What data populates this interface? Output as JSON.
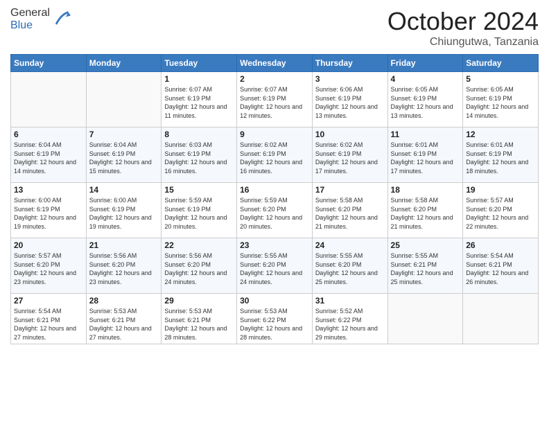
{
  "logo": {
    "general": "General",
    "blue": "Blue"
  },
  "title": "October 2024",
  "subtitle": "Chiungutwa, Tanzania",
  "days_of_week": [
    "Sunday",
    "Monday",
    "Tuesday",
    "Wednesday",
    "Thursday",
    "Friday",
    "Saturday"
  ],
  "weeks": [
    [
      {
        "day": "",
        "info": ""
      },
      {
        "day": "",
        "info": ""
      },
      {
        "day": "1",
        "info": "Sunrise: 6:07 AM\nSunset: 6:19 PM\nDaylight: 12 hours and 11 minutes."
      },
      {
        "day": "2",
        "info": "Sunrise: 6:07 AM\nSunset: 6:19 PM\nDaylight: 12 hours and 12 minutes."
      },
      {
        "day": "3",
        "info": "Sunrise: 6:06 AM\nSunset: 6:19 PM\nDaylight: 12 hours and 13 minutes."
      },
      {
        "day": "4",
        "info": "Sunrise: 6:05 AM\nSunset: 6:19 PM\nDaylight: 12 hours and 13 minutes."
      },
      {
        "day": "5",
        "info": "Sunrise: 6:05 AM\nSunset: 6:19 PM\nDaylight: 12 hours and 14 minutes."
      }
    ],
    [
      {
        "day": "6",
        "info": "Sunrise: 6:04 AM\nSunset: 6:19 PM\nDaylight: 12 hours and 14 minutes."
      },
      {
        "day": "7",
        "info": "Sunrise: 6:04 AM\nSunset: 6:19 PM\nDaylight: 12 hours and 15 minutes."
      },
      {
        "day": "8",
        "info": "Sunrise: 6:03 AM\nSunset: 6:19 PM\nDaylight: 12 hours and 16 minutes."
      },
      {
        "day": "9",
        "info": "Sunrise: 6:02 AM\nSunset: 6:19 PM\nDaylight: 12 hours and 16 minutes."
      },
      {
        "day": "10",
        "info": "Sunrise: 6:02 AM\nSunset: 6:19 PM\nDaylight: 12 hours and 17 minutes."
      },
      {
        "day": "11",
        "info": "Sunrise: 6:01 AM\nSunset: 6:19 PM\nDaylight: 12 hours and 17 minutes."
      },
      {
        "day": "12",
        "info": "Sunrise: 6:01 AM\nSunset: 6:19 PM\nDaylight: 12 hours and 18 minutes."
      }
    ],
    [
      {
        "day": "13",
        "info": "Sunrise: 6:00 AM\nSunset: 6:19 PM\nDaylight: 12 hours and 19 minutes."
      },
      {
        "day": "14",
        "info": "Sunrise: 6:00 AM\nSunset: 6:19 PM\nDaylight: 12 hours and 19 minutes."
      },
      {
        "day": "15",
        "info": "Sunrise: 5:59 AM\nSunset: 6:19 PM\nDaylight: 12 hours and 20 minutes."
      },
      {
        "day": "16",
        "info": "Sunrise: 5:59 AM\nSunset: 6:20 PM\nDaylight: 12 hours and 20 minutes."
      },
      {
        "day": "17",
        "info": "Sunrise: 5:58 AM\nSunset: 6:20 PM\nDaylight: 12 hours and 21 minutes."
      },
      {
        "day": "18",
        "info": "Sunrise: 5:58 AM\nSunset: 6:20 PM\nDaylight: 12 hours and 21 minutes."
      },
      {
        "day": "19",
        "info": "Sunrise: 5:57 AM\nSunset: 6:20 PM\nDaylight: 12 hours and 22 minutes."
      }
    ],
    [
      {
        "day": "20",
        "info": "Sunrise: 5:57 AM\nSunset: 6:20 PM\nDaylight: 12 hours and 23 minutes."
      },
      {
        "day": "21",
        "info": "Sunrise: 5:56 AM\nSunset: 6:20 PM\nDaylight: 12 hours and 23 minutes."
      },
      {
        "day": "22",
        "info": "Sunrise: 5:56 AM\nSunset: 6:20 PM\nDaylight: 12 hours and 24 minutes."
      },
      {
        "day": "23",
        "info": "Sunrise: 5:55 AM\nSunset: 6:20 PM\nDaylight: 12 hours and 24 minutes."
      },
      {
        "day": "24",
        "info": "Sunrise: 5:55 AM\nSunset: 6:20 PM\nDaylight: 12 hours and 25 minutes."
      },
      {
        "day": "25",
        "info": "Sunrise: 5:55 AM\nSunset: 6:21 PM\nDaylight: 12 hours and 25 minutes."
      },
      {
        "day": "26",
        "info": "Sunrise: 5:54 AM\nSunset: 6:21 PM\nDaylight: 12 hours and 26 minutes."
      }
    ],
    [
      {
        "day": "27",
        "info": "Sunrise: 5:54 AM\nSunset: 6:21 PM\nDaylight: 12 hours and 27 minutes."
      },
      {
        "day": "28",
        "info": "Sunrise: 5:53 AM\nSunset: 6:21 PM\nDaylight: 12 hours and 27 minutes."
      },
      {
        "day": "29",
        "info": "Sunrise: 5:53 AM\nSunset: 6:21 PM\nDaylight: 12 hours and 28 minutes."
      },
      {
        "day": "30",
        "info": "Sunrise: 5:53 AM\nSunset: 6:22 PM\nDaylight: 12 hours and 28 minutes."
      },
      {
        "day": "31",
        "info": "Sunrise: 5:52 AM\nSunset: 6:22 PM\nDaylight: 12 hours and 29 minutes."
      },
      {
        "day": "",
        "info": ""
      },
      {
        "day": "",
        "info": ""
      }
    ]
  ]
}
